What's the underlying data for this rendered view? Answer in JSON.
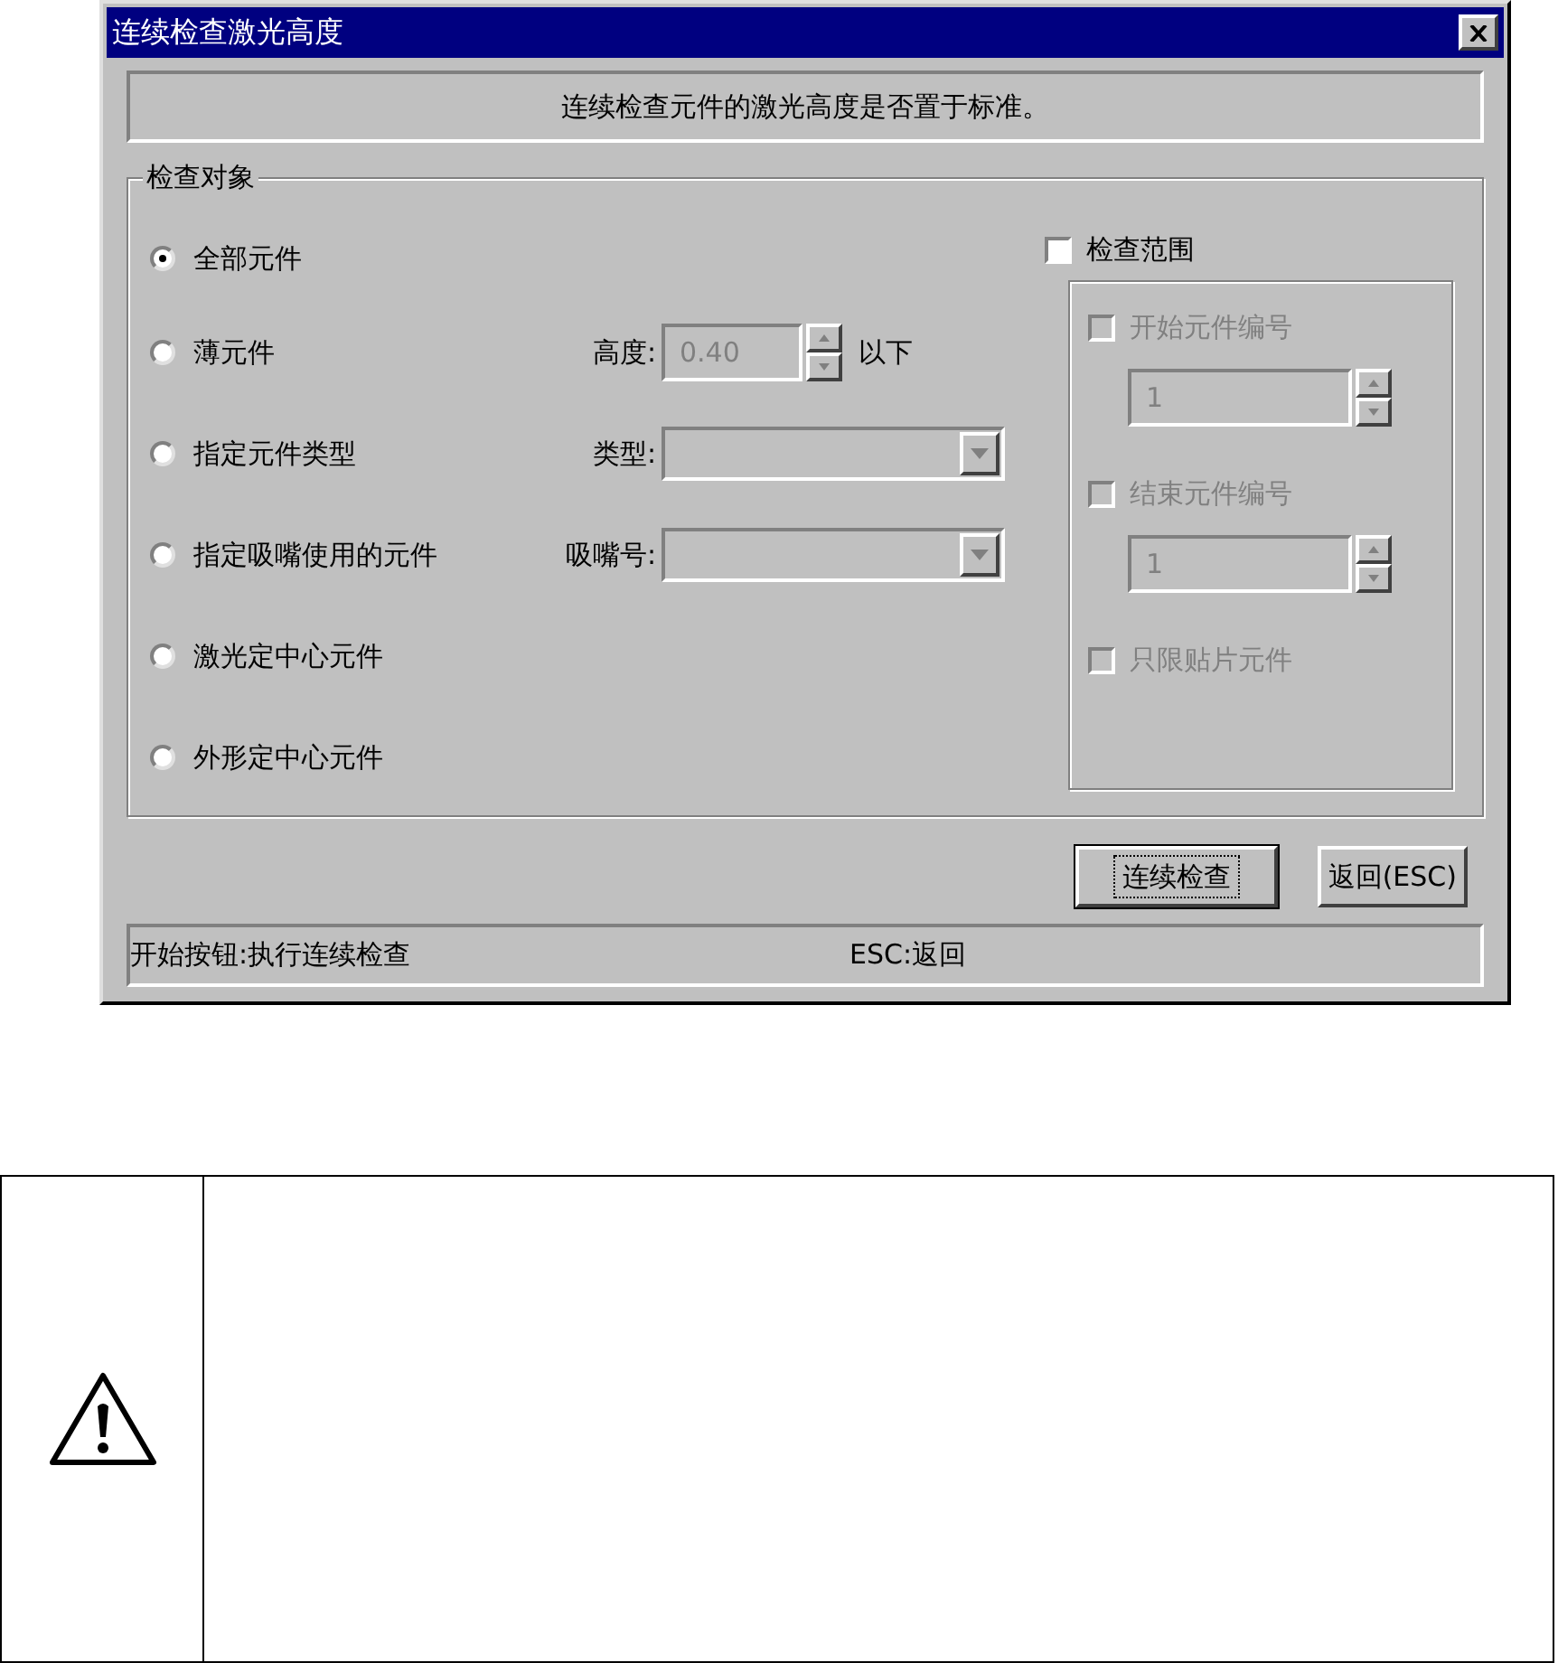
{
  "window": {
    "title": "连续检查激光高度"
  },
  "description": "连续检查元件的激光高度是否置于标准。",
  "target_group": {
    "title": "检查对象",
    "options": [
      {
        "label": "全部元件",
        "selected": true
      },
      {
        "label": "薄元件",
        "selected": false,
        "field": {
          "kind": "spin",
          "label": "高度:",
          "value": "0.40",
          "suffix": "以下",
          "disabled": true
        }
      },
      {
        "label": "指定元件类型",
        "selected": false,
        "field": {
          "kind": "combo",
          "label": "类型:",
          "disabled": true
        }
      },
      {
        "label": "指定吸嘴使用的元件",
        "selected": false,
        "field": {
          "kind": "combo",
          "label": "吸嘴号:",
          "disabled": true
        }
      },
      {
        "label": "激光定中心元件",
        "selected": false
      },
      {
        "label": "外形定中心元件",
        "selected": false
      }
    ]
  },
  "range": {
    "label": "检查范围",
    "checked": false,
    "items": [
      {
        "kind": "checkbox",
        "label": "开始元件编号",
        "checked": false,
        "disabled": true
      },
      {
        "kind": "spin",
        "value": "1",
        "disabled": true
      },
      {
        "kind": "checkbox",
        "label": "结束元件编号",
        "checked": false,
        "disabled": true
      },
      {
        "kind": "spin",
        "value": "1",
        "disabled": true
      },
      {
        "kind": "checkbox",
        "label": "只限贴片元件",
        "checked": false,
        "disabled": true
      }
    ]
  },
  "buttons": [
    {
      "label": "连续检查",
      "focused": true
    },
    {
      "label": "返回(ESC)",
      "focused": false
    }
  ],
  "status_bar": [
    "开始按钮:执行连续检查",
    "ESC:返回"
  ]
}
